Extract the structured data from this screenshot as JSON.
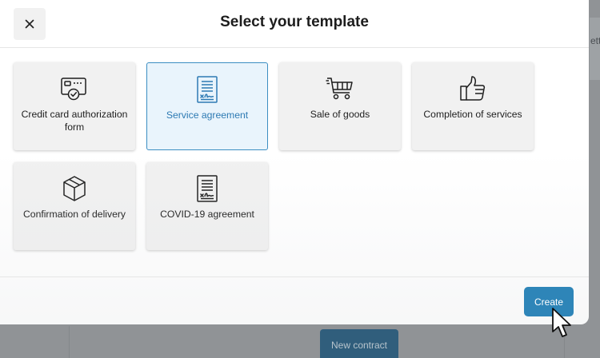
{
  "modal": {
    "title": "Select your template",
    "close_icon": "close-icon"
  },
  "templates": [
    {
      "label": "Credit card authorization form",
      "icon": "credit-card-check-icon",
      "selected": false
    },
    {
      "label": "Service agreement",
      "icon": "document-signature-icon",
      "selected": true
    },
    {
      "label": "Sale of goods",
      "icon": "shopping-cart-icon",
      "selected": false
    },
    {
      "label": "Completion of services",
      "icon": "thumbs-up-icon",
      "selected": false
    },
    {
      "label": "Confirmation of delivery",
      "icon": "box-icon",
      "selected": false
    },
    {
      "label": "COVID-19 agreement",
      "icon": "document-signature-icon",
      "selected": false
    }
  ],
  "footer": {
    "create_label": "Create"
  },
  "background": {
    "new_contract_label": "New contract",
    "right_fragment": "ett"
  },
  "colors": {
    "accent": "#2e85b8",
    "selected_bg": "#e9f4fc",
    "selected_border": "#3b8ec2",
    "card_bg": "#f1f1f1"
  }
}
